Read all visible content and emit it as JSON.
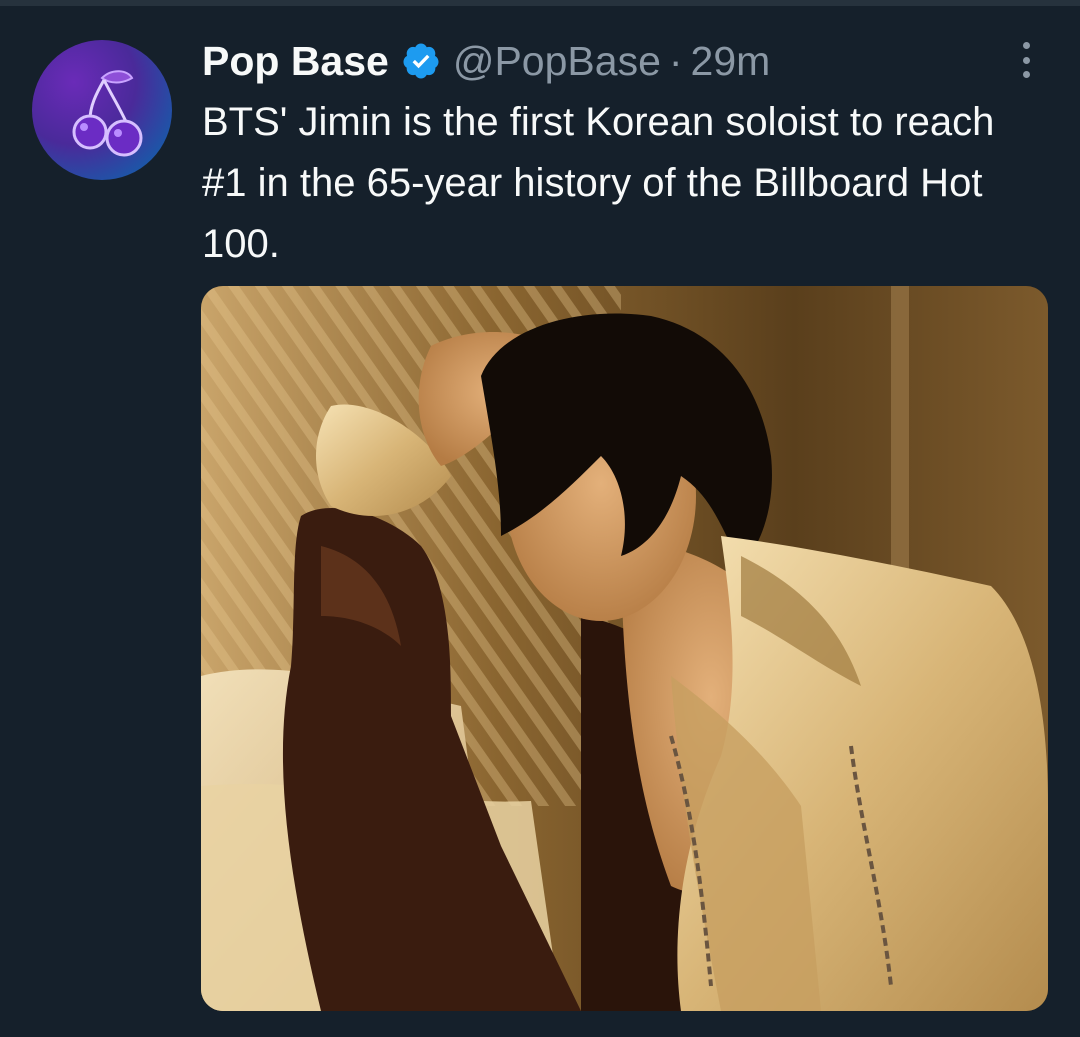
{
  "tweet": {
    "display_name": "Pop Base",
    "verified_icon": "verified-badge-icon",
    "handle": "@PopBase",
    "separator": "·",
    "time": "29m",
    "more_icon": "more-options-icon",
    "text": "BTS' Jimin is the first Korean soloist to reach #1 in the 65-year history of the Billboard Hot 100.",
    "avatar_icon": "cherries-logo-icon",
    "media_icon": "photo"
  },
  "colors": {
    "background": "#15202b",
    "primary_text": "#f7f9f9",
    "secondary_text": "#8b98a5",
    "verified": "#1d9bf0"
  }
}
